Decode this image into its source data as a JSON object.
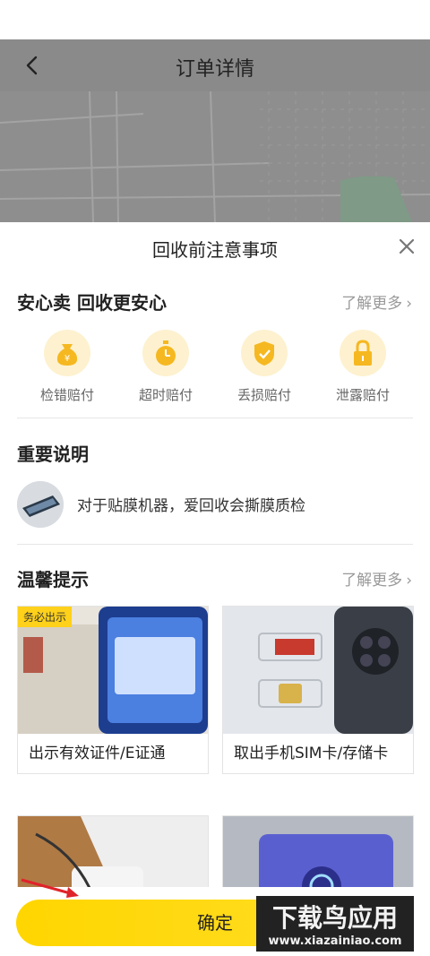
{
  "header": {
    "title": "订单详情"
  },
  "sheet": {
    "title": "回收前注意事项",
    "safety": {
      "title": "安心卖 回收更安心",
      "more": "了解更多",
      "items": [
        {
          "label": "检错赔付",
          "icon": "money-bag-icon"
        },
        {
          "label": "超时赔付",
          "icon": "clock-icon"
        },
        {
          "label": "丢损赔付",
          "icon": "shield-check-icon"
        },
        {
          "label": "泄露赔付",
          "icon": "lock-icon"
        }
      ]
    },
    "important": {
      "title": "重要说明",
      "note": "对于贴膜机器，爱回收会撕膜质检"
    },
    "tips": {
      "title": "温馨提示",
      "more": "了解更多",
      "cards": [
        {
          "caption": "出示有效证件/E证通",
          "badge": "务必出示"
        },
        {
          "caption": "取出手机SIM卡/存储卡"
        },
        {
          "caption": ""
        },
        {
          "caption": ""
        }
      ]
    }
  },
  "footer": {
    "confirm": "确定"
  },
  "watermark": {
    "text": "下载鸟应用",
    "url": "www.xiazainiao.com"
  },
  "colors": {
    "accent": "#ffd600",
    "icon_bg": "#fdf1cf",
    "icon_fg": "#f6b820"
  }
}
